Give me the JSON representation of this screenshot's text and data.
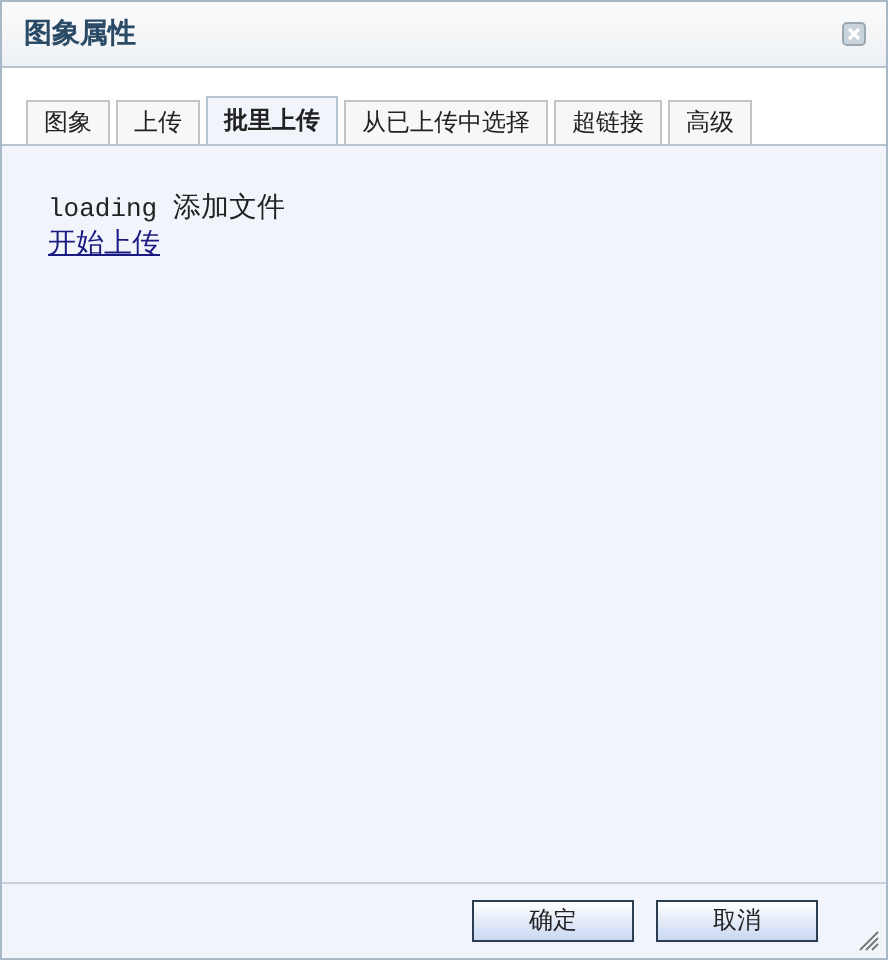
{
  "window": {
    "title": "图象属性"
  },
  "tabs": [
    {
      "label": "图象",
      "selected": false
    },
    {
      "label": "上传",
      "selected": false
    },
    {
      "label": "批里上传",
      "selected": true
    },
    {
      "label": "从已上传中选择",
      "selected": false
    },
    {
      "label": "超链接",
      "selected": false
    },
    {
      "label": "高级",
      "selected": false
    }
  ],
  "panel": {
    "status": "loading",
    "add_files": "添加文件",
    "start_link": "开始上传"
  },
  "buttons": [
    "确定",
    "取消"
  ]
}
